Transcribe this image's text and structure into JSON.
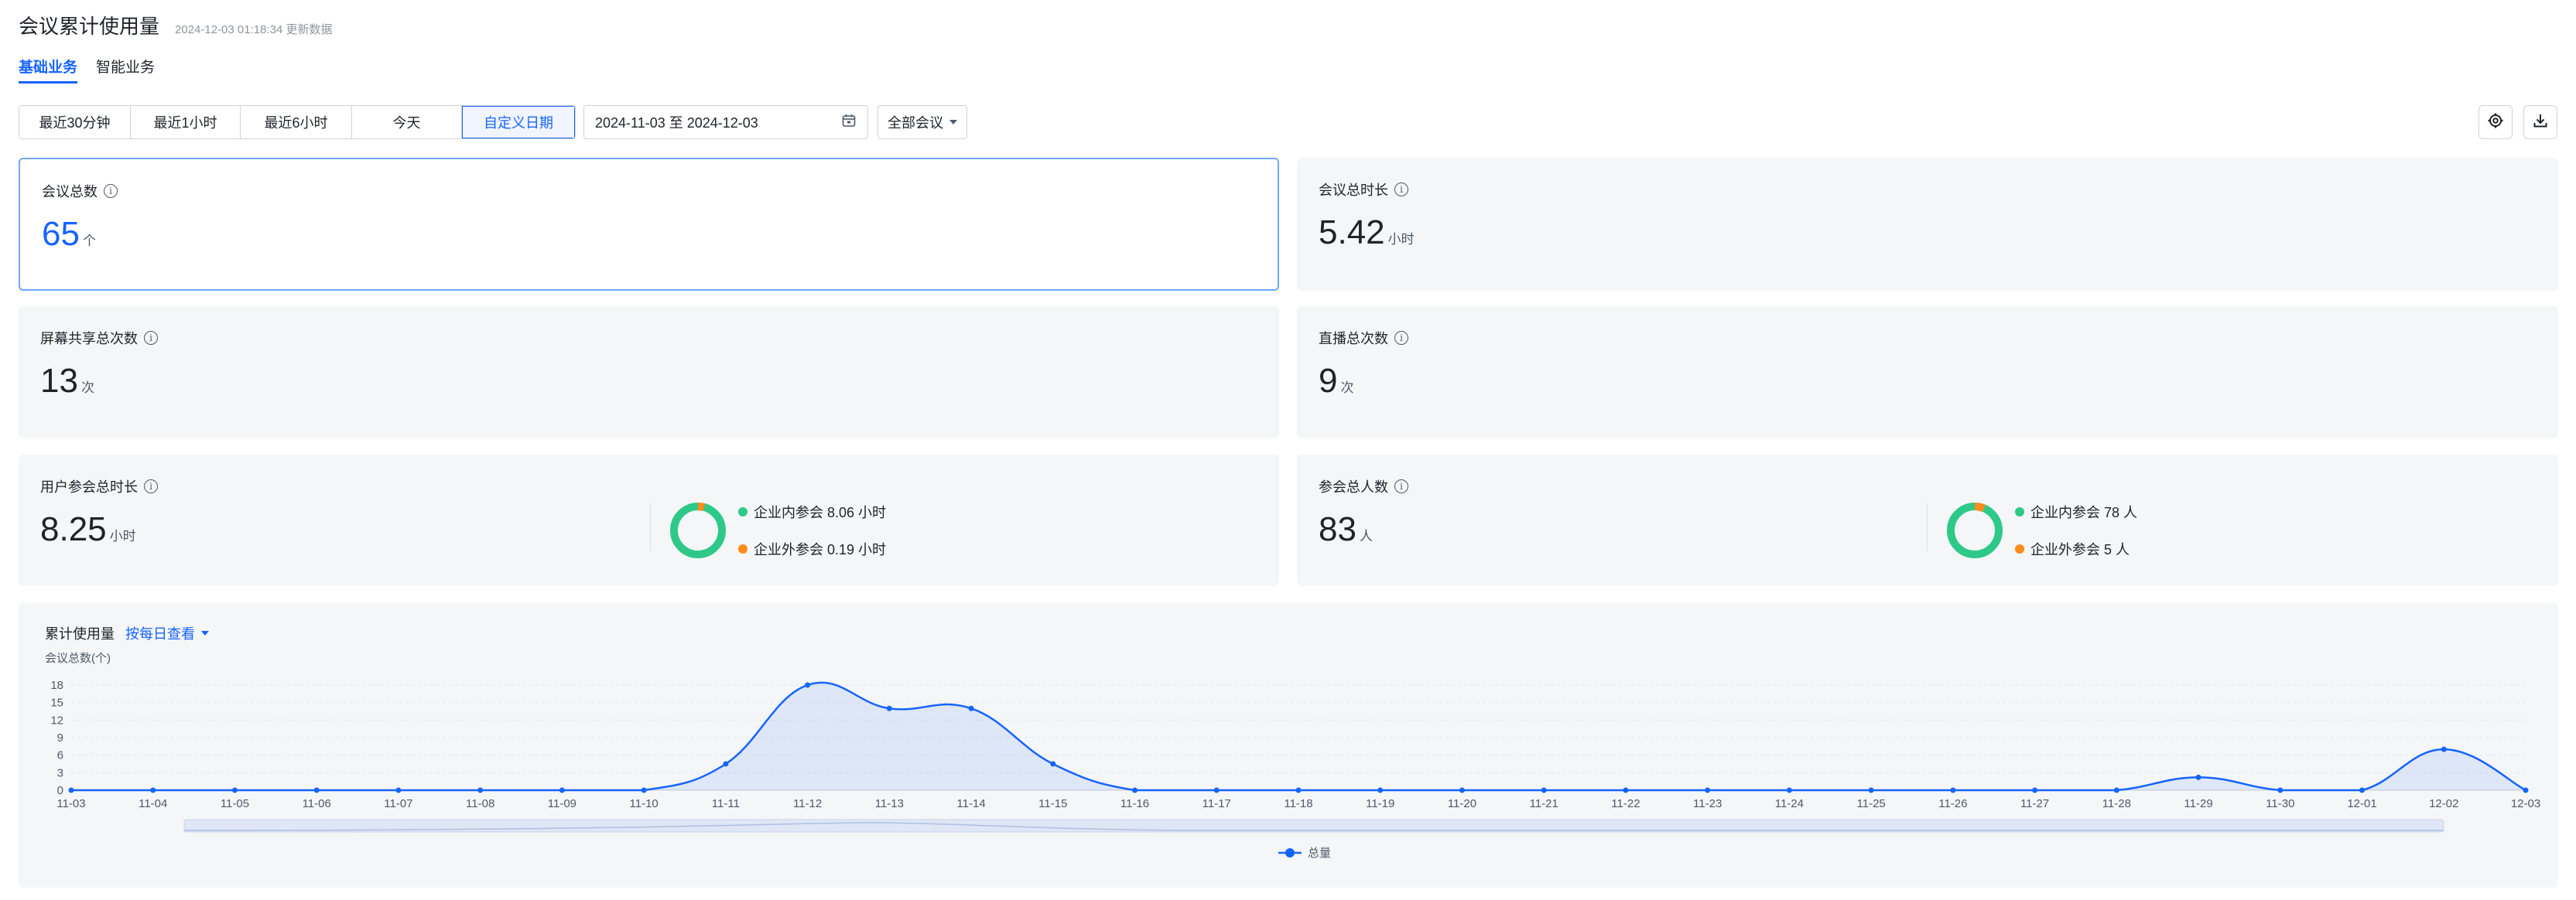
{
  "header": {
    "title": "会议累计使用量",
    "updated": "2024-12-03 01:18:34 更新数据"
  },
  "tabs": [
    {
      "label": "基础业务",
      "active": true
    },
    {
      "label": "智能业务",
      "active": false
    }
  ],
  "toolbar": {
    "ranges": [
      "最近30分钟",
      "最近1小时",
      "最近6小时",
      "今天",
      "自定义日期"
    ],
    "active_range": "自定义日期",
    "date_range": "2024-11-03 至 2024-12-03",
    "meeting_filter": "全部会议",
    "icons": [
      "settings-icon",
      "download-icon",
      "calendar-icon"
    ]
  },
  "cards": {
    "meeting_total": {
      "label": "会议总数",
      "value": "65",
      "unit": "个"
    },
    "meeting_duration": {
      "label": "会议总时长",
      "value": "5.42",
      "unit": "小时"
    },
    "screen_share": {
      "label": "屏幕共享总次数",
      "value": "13",
      "unit": "次"
    },
    "live": {
      "label": "直播总次数",
      "value": "9",
      "unit": "次"
    },
    "user_duration": {
      "label": "用户参会总时长",
      "value": "8.25",
      "unit": "小时",
      "legend": [
        {
          "label": "企业内参会 8.06 小时",
          "value": 8.06,
          "color": "#2ec989"
        },
        {
          "label": "企业外参会 0.19 小时",
          "value": 0.19,
          "color": "#ff8b1a"
        }
      ]
    },
    "participants": {
      "label": "参会总人数",
      "value": "83",
      "unit": "人",
      "legend": [
        {
          "label": "企业内参会 78 人",
          "value": 78,
          "color": "#2ec989"
        },
        {
          "label": "企业外参会 5 人",
          "value": 5,
          "color": "#ff8b1a"
        }
      ]
    }
  },
  "chart_section": {
    "title": "累计使用量",
    "view_label": "按每日查看"
  },
  "chart_data": {
    "type": "line",
    "ylabel": "会议总数(个)",
    "ylim": [
      0,
      18
    ],
    "yticks": [
      0,
      3,
      6,
      9,
      12,
      15,
      18
    ],
    "categories": [
      "11-03",
      "11-04",
      "11-05",
      "11-06",
      "11-07",
      "11-08",
      "11-09",
      "11-10",
      "11-11",
      "11-12",
      "11-13",
      "11-14",
      "11-15",
      "11-16",
      "11-17",
      "11-18",
      "11-19",
      "11-20",
      "11-21",
      "11-22",
      "11-23",
      "11-24",
      "11-25",
      "11-26",
      "11-27",
      "11-28",
      "11-29",
      "11-30",
      "12-01",
      "12-02",
      "12-03"
    ],
    "series": [
      {
        "name": "总量",
        "color": "#1664ff",
        "values": [
          0,
          0,
          0,
          0,
          0,
          0,
          0,
          0,
          4.5,
          18,
          14,
          14,
          4.5,
          0,
          0,
          0,
          0,
          0,
          0,
          0,
          0,
          0,
          0,
          0,
          0,
          0,
          2.2,
          0,
          0,
          7,
          0
        ]
      }
    ],
    "legend": "bottom-center"
  }
}
